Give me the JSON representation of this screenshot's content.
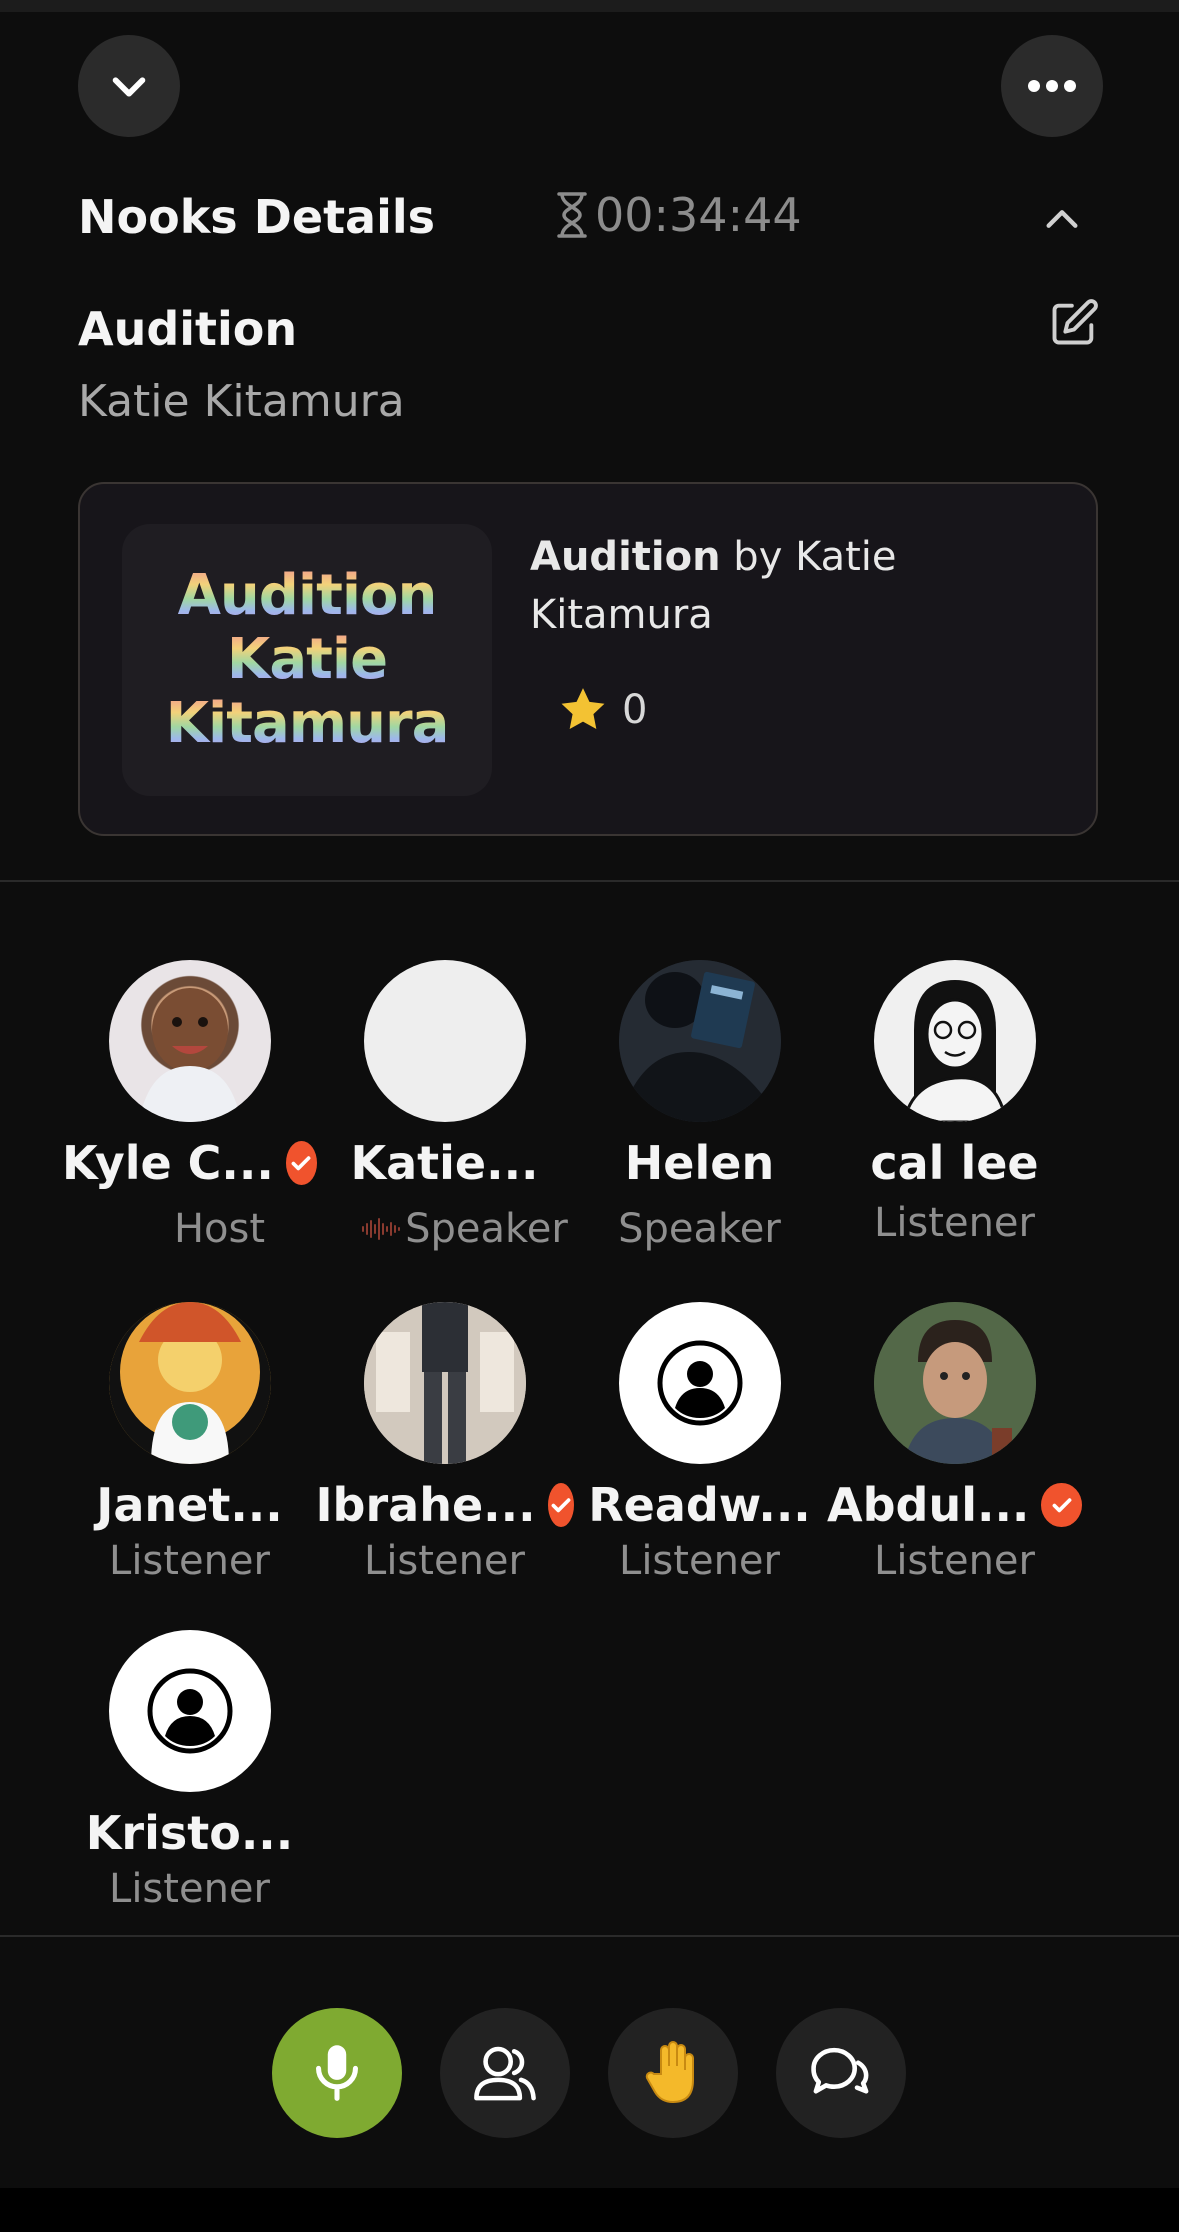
{
  "header": {
    "collapse_icon": "chevron-down-icon",
    "more_icon": "more-horizontal-icon"
  },
  "details": {
    "title": "Nooks Details",
    "timer": "00:34:44",
    "timer_icon": "hourglass-icon",
    "toggle_icon": "chevron-up-icon"
  },
  "room": {
    "title": "Audition",
    "host": "Katie Kitamura",
    "edit_icon": "edit-icon"
  },
  "book": {
    "cover_lines": [
      "Audition",
      "Katie",
      "Kitamura"
    ],
    "title": "Audition",
    "by": "by",
    "author": "Katie Kitamura",
    "rating": "0",
    "rating_icon": "star-icon"
  },
  "participants": [
    {
      "name": "Kyle C...",
      "role": "Host",
      "verified": true
    },
    {
      "name": "Katie...",
      "role": "Speaker",
      "verified": false,
      "speaking": true
    },
    {
      "name": "Helen",
      "role": "Speaker",
      "verified": false
    },
    {
      "name": "cal lee",
      "role": "Listener",
      "verified": false
    },
    {
      "name": "Janet...",
      "role": "Listener",
      "verified": false
    },
    {
      "name": "Ibrahe...",
      "role": "Listener",
      "verified": true
    },
    {
      "name": "Readw...",
      "role": "Listener",
      "verified": false
    },
    {
      "name": "Abdul...",
      "role": "Listener",
      "verified": true
    },
    {
      "name": "Kristo...",
      "role": "Listener",
      "verified": false
    }
  ],
  "actions": {
    "mic_icon": "microphone-icon",
    "people_icon": "people-icon",
    "hand_icon": "raise-hand-icon",
    "chat_icon": "chat-icon"
  },
  "colors": {
    "accent_green": "#7faa31",
    "verified_orange": "#f0532d",
    "star_yellow": "#f3c233",
    "background": "#0d0d0d"
  }
}
